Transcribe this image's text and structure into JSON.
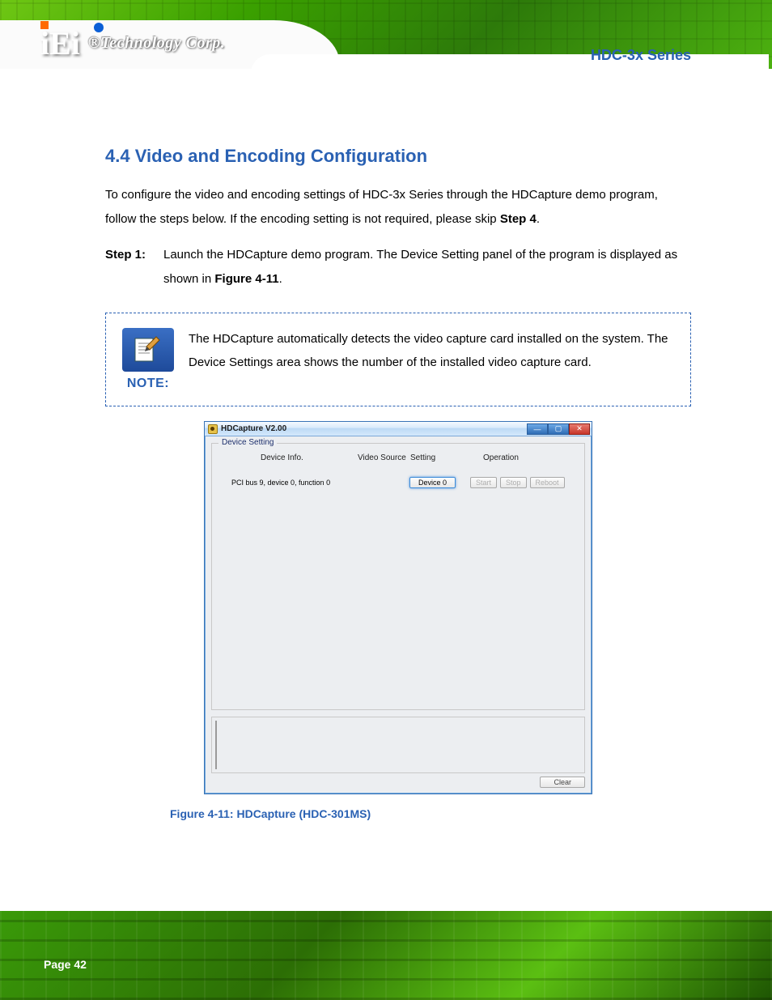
{
  "header": {
    "logo_text": "iEi",
    "tagline": "®Technology Corp.",
    "doc_title": "HDC-3x Series"
  },
  "section": {
    "heading": "4.4 Video and Encoding Configuration",
    "intro": "To configure the video and encoding settings of HDC-3x Series through the HDCapture demo program, follow the steps below. If the encoding setting is not required, please skip",
    "intro_bold": "Step 4",
    "intro_tail": ".",
    "step1_label": "Step 1:",
    "step1_text_a": "Launch the HDCapture demo program. The Device Setting panel of the program is displayed as shown in ",
    "step1_fig_ref": "Figure 4-11",
    "step1_text_b": ".",
    "note_label": "NOTE:",
    "note_text": "The HDCapture automatically detects the video capture card installed on the system. The Device Settings area shows the number of the installed video capture card."
  },
  "figure": {
    "window_title": "HDCapture V2.00",
    "group_title": "Device Setting",
    "headers": {
      "device_info": "Device Info.",
      "video_source": "Video Source",
      "setting": "Setting",
      "operation": "Operation"
    },
    "row": {
      "info": "PCI bus 9, device 0, function 0",
      "device_btn": "Device 0",
      "start_btn": "Start",
      "stop_btn": "Stop",
      "reboot_btn": "Reboot"
    },
    "clear_btn": "Clear",
    "caption": "Figure 4-11: HDCapture (HDC-301MS)"
  },
  "footer": {
    "page": "Page 42"
  },
  "win_controls": {
    "min": "—",
    "max": "▢",
    "close": "✕"
  }
}
